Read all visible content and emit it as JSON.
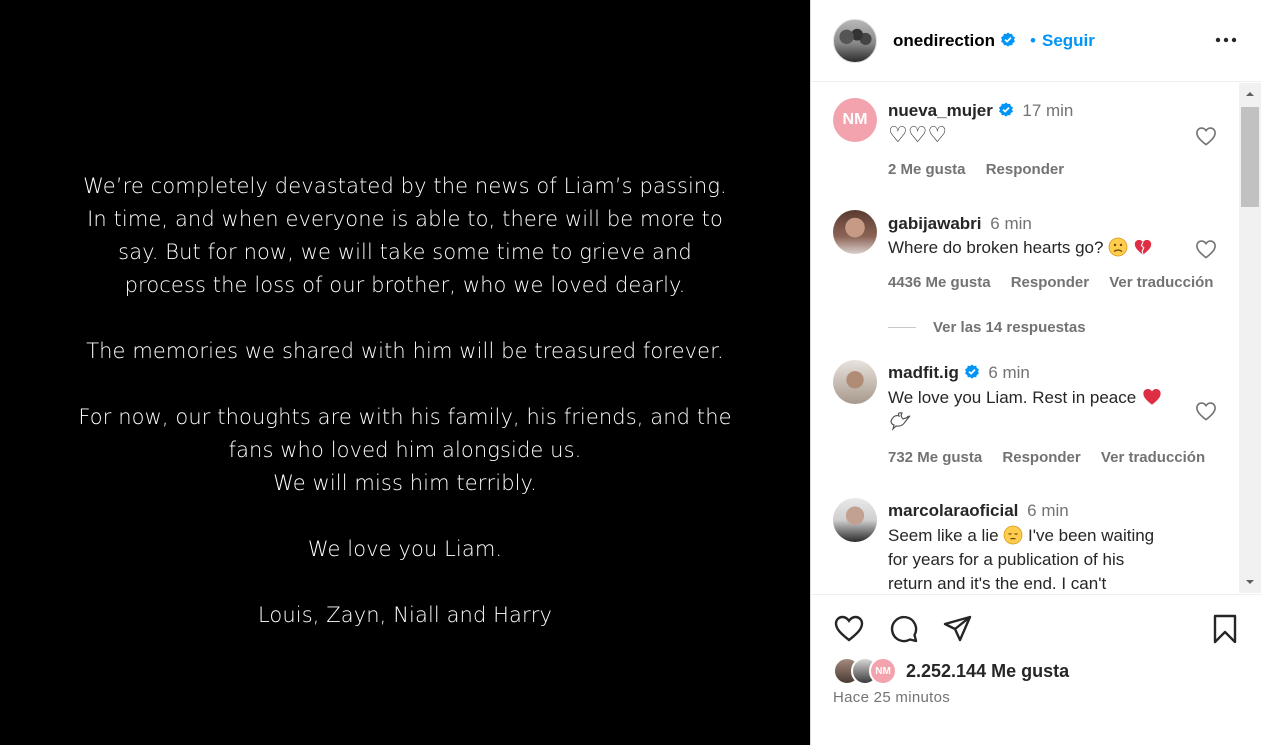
{
  "post": {
    "lines_p1": [
      "We’re completely devastated by the news of Liam’s passing.",
      "In time, and when everyone is able to, there will be more to",
      "say. But for now, we will take some time to grieve and",
      "process the loss of our brother, who we loved dearly."
    ],
    "line_p2": "The memories we shared with him will be treasured forever.",
    "lines_p3": [
      "For now, our thoughts are with his family, his friends, and the",
      "fans who loved him alongside us.",
      "We will miss him terribly."
    ],
    "line_p4": "We love you Liam.",
    "line_p5": "Louis, Zayn, Niall and Harry"
  },
  "header": {
    "username": "onedirection",
    "dot": "•",
    "follow_label": "Seguir"
  },
  "comments": [
    {
      "avatar_text": "NM",
      "username": "nueva_mujer",
      "time": "17 min",
      "text": "♡♡♡",
      "likes": "2 Me gusta",
      "reply": "Responder"
    },
    {
      "username": "gabijawabri",
      "time": "6 min",
      "text": "Where do broken hearts go?",
      "likes": "4436 Me gusta",
      "reply": "Responder",
      "translate": "Ver traducción"
    },
    {
      "username": "madfit.ig",
      "time": "6 min",
      "text": "We love you Liam. Rest in peace",
      "likes": "732 Me gusta",
      "reply": "Responder",
      "translate": "Ver traducción"
    },
    {
      "username": "marcolaraoficial",
      "time": "6 min",
      "text_line1": "Seem like a lie",
      "text_line1b": "I've been waiting",
      "text_line2": "for years for a publication of his",
      "text_line3": "return and it's the end. I can't"
    }
  ],
  "replies": {
    "label": "Ver las 14 respuestas"
  },
  "actions": {
    "likes_count": "2.252.144 Me gusta",
    "mini_avatar_text": "NM",
    "posted": "Hace 25 minutos"
  },
  "colors": {
    "accent": "#0095f6",
    "heart": "#e0245e",
    "image_bg": "#000000"
  }
}
